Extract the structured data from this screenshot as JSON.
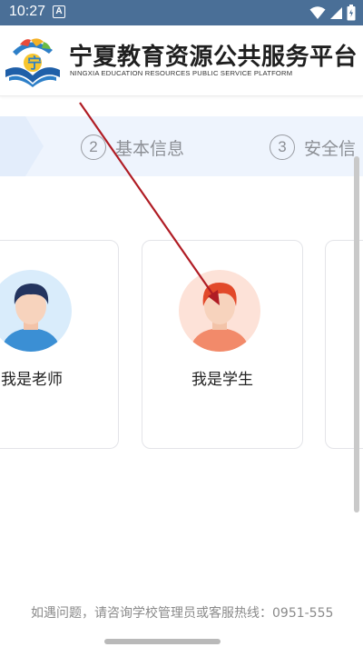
{
  "status_bar": {
    "time": "10:27",
    "notification_letter": "A"
  },
  "header": {
    "title": "宁夏教育资源公共服务平台",
    "subtitle": "NINGXIA EDUCATION RESOURCES PUBLIC SERVICE PLATFORM"
  },
  "steps": [
    {
      "number": "2",
      "label": "基本信息"
    },
    {
      "number": "3",
      "label": "安全信"
    }
  ],
  "roles": [
    {
      "label": "我是老师"
    },
    {
      "label": "我是学生"
    }
  ],
  "footer": {
    "help_text": "如遇问题，请咨询学校管理员或客服热线：0951-555"
  },
  "colors": {
    "status_bar": "#4a6f97",
    "step_bg": "#eef4fd",
    "annotation_arrow": "#b01c24"
  }
}
